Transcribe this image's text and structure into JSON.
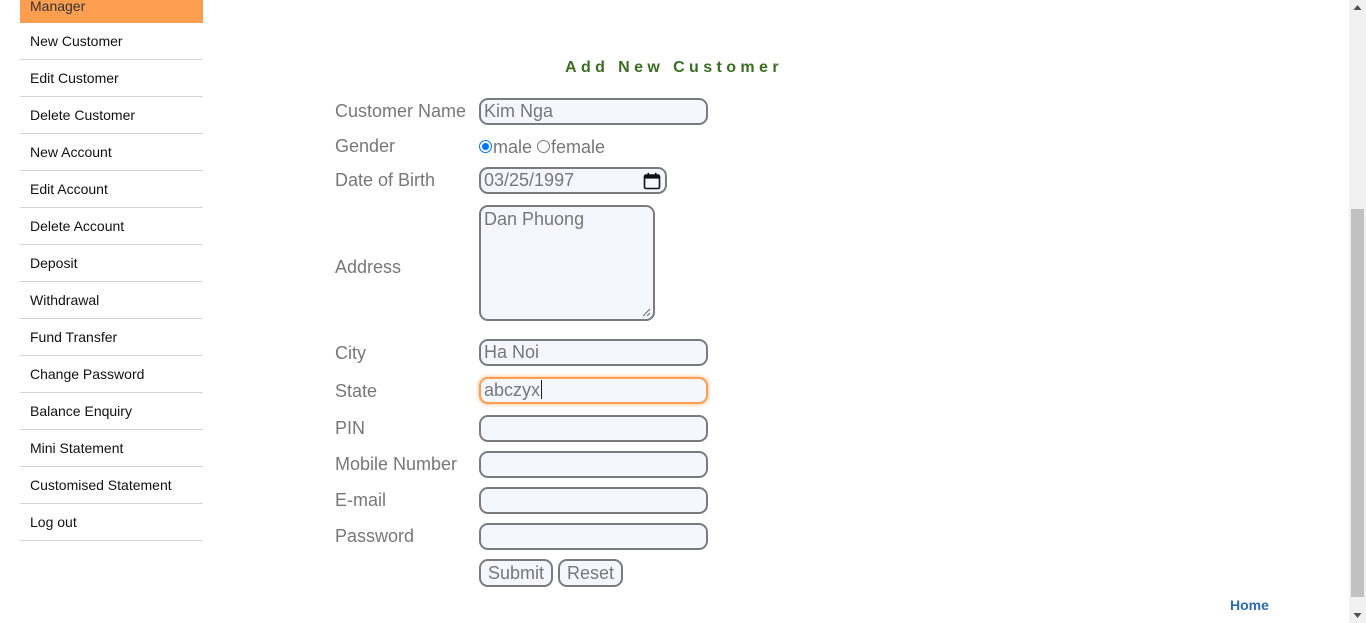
{
  "sidebar": {
    "header": "Manager",
    "items": [
      {
        "label": "New Customer"
      },
      {
        "label": "Edit Customer"
      },
      {
        "label": "Delete Customer"
      },
      {
        "label": "New Account"
      },
      {
        "label": "Edit Account"
      },
      {
        "label": "Delete Account"
      },
      {
        "label": "Deposit"
      },
      {
        "label": "Withdrawal"
      },
      {
        "label": "Fund Transfer"
      },
      {
        "label": "Change Password"
      },
      {
        "label": "Balance Enquiry"
      },
      {
        "label": "Mini Statement"
      },
      {
        "label": "Customised Statement"
      },
      {
        "label": "Log out"
      }
    ]
  },
  "form": {
    "title": "Add New Customer",
    "labels": {
      "customer_name": "Customer Name",
      "gender": "Gender",
      "dob": "Date of Birth",
      "address": "Address",
      "city": "City",
      "state": "State",
      "pin": "PIN",
      "mobile": "Mobile Number",
      "email": "E-mail",
      "password": "Password"
    },
    "values": {
      "customer_name": "Kim Nga",
      "gender_selected": "male",
      "dob": "03/25/1997",
      "address": "Dan Phuong",
      "city": "Ha Noi",
      "state": "abczyx",
      "pin": "",
      "mobile": "",
      "email": "",
      "password": ""
    },
    "gender_options": {
      "male": "male",
      "female": "female"
    },
    "buttons": {
      "submit": "Submit",
      "reset": "Reset"
    }
  },
  "footer": {
    "home_link": "Home"
  },
  "colors": {
    "sidebar_header_bg": "#FB9E50",
    "title": "#3B6E22",
    "focus": "#FB9E50",
    "link": "#2B6BAE",
    "radio_selected": "#0075FF"
  },
  "icons": {
    "calendar": "calendar-icon",
    "resize": "resize-grip-icon",
    "scroll_up": "arrow-up-icon",
    "scroll_down": "arrow-down-icon"
  }
}
